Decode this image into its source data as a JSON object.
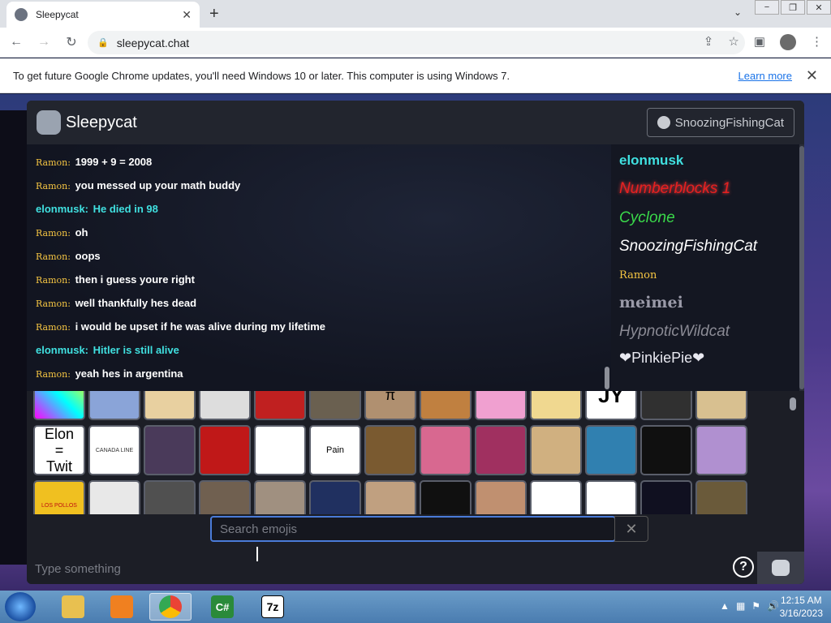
{
  "browser": {
    "tab_title": "Sleepycat",
    "tab_close": "✕",
    "new_tab": "+",
    "tab_menu": "⌄",
    "url": "sleepycat.chat",
    "window_controls": [
      "−",
      "❐",
      "✕"
    ]
  },
  "infobar": {
    "message": "To get future Google Chrome updates, you'll need Windows 10 or later. This computer is using Windows 7.",
    "learn_more": "Learn more",
    "close": "✕"
  },
  "app": {
    "name": "Sleepycat",
    "user_button": "SnoozingFishingCat"
  },
  "messages": [
    {
      "user": "Ramon:",
      "text": "1999 + 9 = 2008",
      "teal": false
    },
    {
      "user": "Ramon:",
      "text": "you messed up your math buddy",
      "teal": false
    },
    {
      "user": "elonmusk:",
      "text": "He died in 98",
      "teal": true
    },
    {
      "user": "Ramon:",
      "text": "oh",
      "teal": false
    },
    {
      "user": "Ramon:",
      "text": "oops",
      "teal": false
    },
    {
      "user": "Ramon:",
      "text": "then i guess youre right",
      "teal": false
    },
    {
      "user": "Ramon:",
      "text": "well thankfully hes dead",
      "teal": false
    },
    {
      "user": "Ramon:",
      "text": "i would be upset if he was alive during my lifetime",
      "teal": false
    },
    {
      "user": "elonmusk:",
      "text": "Hitler is still alive",
      "teal": true
    },
    {
      "user": "Ramon:",
      "text": "yeah hes in argentina",
      "teal": false
    }
  ],
  "online_users": [
    "elonmusk",
    "Numberblocks 1",
    "Cyclone",
    "SnoozingFishingCat",
    "Ramon",
    "meimei",
    "HypnoticWildcat",
    "❤PinkiePie❤"
  ],
  "emoji_labels": {
    "elon_twit": "Elon\n=\nTwit",
    "pain": "Pain",
    "pi": "π",
    "jy": "JY",
    "canada": "CANADA LINE",
    "los_pollos": "LOS POLLOS"
  },
  "emoji_search": {
    "placeholder": "Search emojis",
    "clear": "✕"
  },
  "chat_input": {
    "placeholder": "Type something",
    "help": "?"
  },
  "taskbar": {
    "time": "12:15 AM",
    "date": "3/16/2023",
    "apps": [
      "explorer",
      "media-player",
      "chrome",
      "csharp",
      "7zip"
    ],
    "csharp_label": "C#",
    "sevenzip_label": "7z"
  }
}
